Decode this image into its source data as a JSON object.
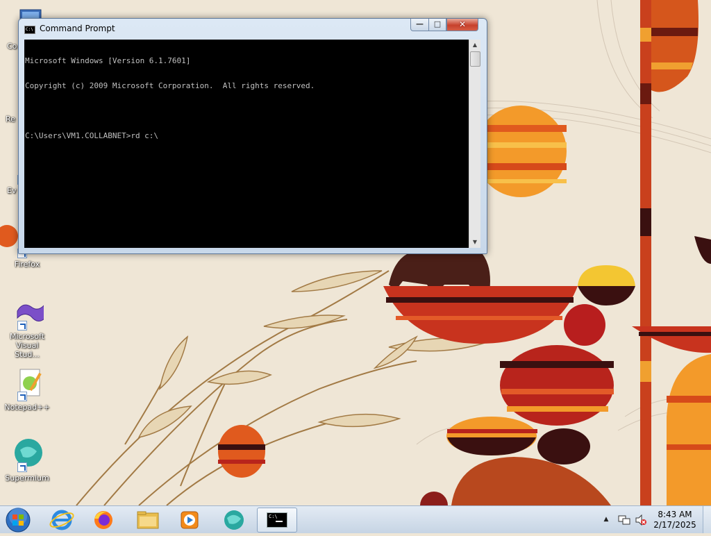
{
  "window": {
    "title": "Command Prompt",
    "title_icon_text": "C:\\",
    "minimize_glyph": "—",
    "maximize_glyph": "□",
    "close_glyph": "✕",
    "console_lines": [
      "Microsoft Windows [Version 6.1.7601]",
      "Copyright (c) 2009 Microsoft Corporation.  All rights reserved.",
      "",
      "C:\\Users\\VM1.COLLABNET>rd c:\\"
    ]
  },
  "desktop_icons": [
    {
      "label": "Co",
      "icon": "computer-icon"
    },
    {
      "label": "Re",
      "icon": "recycle-bin-icon"
    },
    {
      "label": "Ev",
      "icon": "shortcut-icon"
    },
    {
      "label": "Firefox",
      "icon": "firefox-icon"
    },
    {
      "label": "Microsoft Visual Stud...",
      "icon": "visual-studio-icon"
    },
    {
      "label": "Notepad++",
      "icon": "notepadpp-icon"
    },
    {
      "label": "Supermium",
      "icon": "supermium-icon"
    }
  ],
  "taskbar": {
    "items": [
      "start-orb",
      "internet-explorer",
      "firefox",
      "file-explorer",
      "media-player",
      "supermium",
      "command-prompt"
    ],
    "cmd_icon_text": "C:\\",
    "clock_time": "8:43 AM",
    "clock_date": "2/17/2025"
  },
  "colors": {
    "console_bg": "#000000",
    "console_fg": "#c0c0c0",
    "close_button": "#c7412c",
    "taskbar": "#d3deeb"
  }
}
